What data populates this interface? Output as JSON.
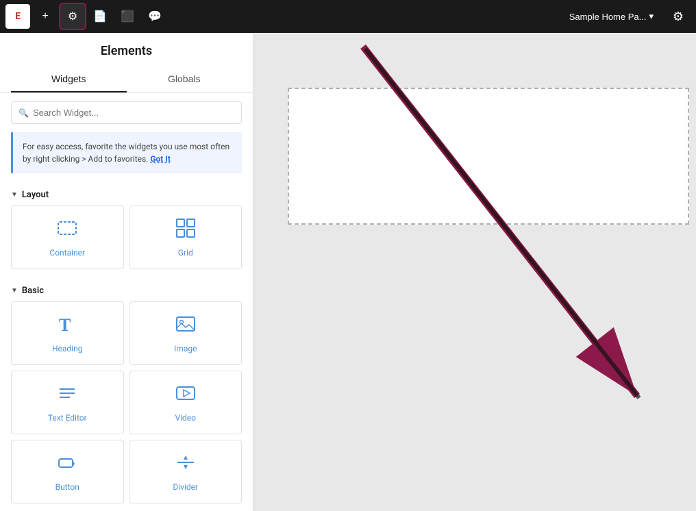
{
  "toolbar": {
    "logo_text": "E",
    "add_label": "+",
    "elements_label": "Elements",
    "page_title": "Sample Home Pa...",
    "tabs": [
      {
        "id": "widgets",
        "label": "Widgets",
        "active": true
      },
      {
        "id": "globals",
        "label": "Globals",
        "active": false
      }
    ],
    "search_placeholder": "Search Widget...",
    "info_text": "For easy access, favorite the widgets you use most often by right clicking > Add to favorites.",
    "got_it_label": "Got It",
    "sections": [
      {
        "id": "layout",
        "label": "Layout",
        "expanded": true,
        "widgets": [
          {
            "id": "container",
            "label": "Container",
            "icon": "container"
          },
          {
            "id": "grid",
            "label": "Grid",
            "icon": "grid"
          }
        ]
      },
      {
        "id": "basic",
        "label": "Basic",
        "expanded": true,
        "widgets": [
          {
            "id": "heading",
            "label": "Heading",
            "icon": "heading"
          },
          {
            "id": "image",
            "label": "Image",
            "icon": "image"
          },
          {
            "id": "text-editor",
            "label": "Text Editor",
            "icon": "text"
          },
          {
            "id": "video",
            "label": "Video",
            "icon": "video"
          },
          {
            "id": "button",
            "label": "Button",
            "icon": "button"
          },
          {
            "id": "divider",
            "label": "Divider",
            "icon": "divider"
          }
        ]
      }
    ]
  }
}
